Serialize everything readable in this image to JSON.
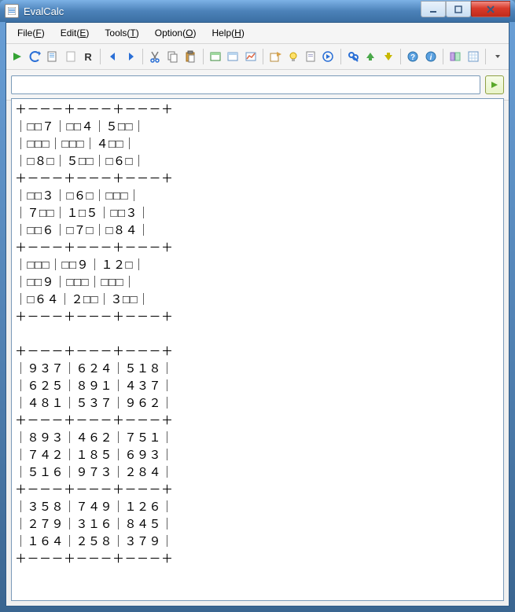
{
  "window": {
    "title": "EvalCalc"
  },
  "menu": {
    "file": {
      "label_pre": "File(",
      "mnemonic": "F",
      "label_post": ")"
    },
    "edit": {
      "label_pre": "Edit(",
      "mnemonic": "E",
      "label_post": ")"
    },
    "tools": {
      "label_pre": "Tools(",
      "mnemonic": "T",
      "label_post": ")"
    },
    "option": {
      "label_pre": "Option(",
      "mnemonic": "O",
      "label_post": ")"
    },
    "help": {
      "label_pre": "Help(",
      "mnemonic": "H",
      "label_post": ")"
    }
  },
  "toolbar": {
    "run_label": "R"
  },
  "input": {
    "expression": "",
    "placeholder": ""
  },
  "output": {
    "lines": [
      "＋－－－＋－－－＋－－－＋",
      "｜□□７｜□□４｜５□□｜",
      "｜□□□｜□□□｜４□□｜",
      "｜□８□｜５□□｜□６□｜",
      "＋－－－＋－－－＋－－－＋",
      "｜□□３｜□６□｜□□□｜",
      "｜７□□｜１□５｜□□３｜",
      "｜□□６｜□７□｜□８４｜",
      "＋－－－＋－－－＋－－－＋",
      "｜□□□｜□□９｜１２□｜",
      "｜□□９｜□□□｜□□□｜",
      "｜□６４｜２□□｜３□□｜",
      "＋－－－＋－－－＋－－－＋",
      "",
      "＋－－－＋－－－＋－－－＋",
      "｜９３７｜６２４｜５１８｜",
      "｜６２５｜８９１｜４３７｜",
      "｜４８１｜５３７｜９６２｜",
      "＋－－－＋－－－＋－－－＋",
      "｜８９３｜４６２｜７５１｜",
      "｜７４２｜１８５｜６９３｜",
      "｜５１６｜９７３｜２８４｜",
      "＋－－－＋－－－＋－－－＋",
      "｜３５８｜７４９｜１２６｜",
      "｜２７９｜３１６｜８４５｜",
      "｜１６４｜２５８｜３７９｜",
      "＋－－－＋－－－＋－－－＋"
    ]
  },
  "chart_data": {
    "type": "table",
    "title": "Sudoku puzzle and solution (9×9)",
    "puzzle_rows": [
      [
        null,
        null,
        7,
        null,
        null,
        4,
        5,
        null,
        null
      ],
      [
        null,
        null,
        null,
        null,
        null,
        null,
        4,
        null,
        null
      ],
      [
        null,
        8,
        null,
        5,
        null,
        null,
        null,
        6,
        null
      ],
      [
        null,
        null,
        3,
        null,
        6,
        null,
        null,
        null,
        null
      ],
      [
        7,
        null,
        null,
        1,
        null,
        5,
        null,
        null,
        3
      ],
      [
        null,
        null,
        6,
        null,
        7,
        null,
        null,
        8,
        4
      ],
      [
        null,
        null,
        null,
        null,
        null,
        9,
        1,
        2,
        null
      ],
      [
        null,
        null,
        9,
        null,
        null,
        null,
        null,
        null,
        null
      ],
      [
        null,
        6,
        4,
        2,
        null,
        null,
        3,
        null,
        null
      ]
    ],
    "solution_rows": [
      [
        9,
        3,
        7,
        6,
        2,
        4,
        5,
        1,
        8
      ],
      [
        6,
        2,
        5,
        8,
        9,
        1,
        4,
        3,
        7
      ],
      [
        4,
        8,
        1,
        5,
        3,
        7,
        9,
        6,
        2
      ],
      [
        8,
        9,
        3,
        4,
        6,
        2,
        7,
        5,
        1
      ],
      [
        7,
        4,
        2,
        1,
        8,
        5,
        6,
        9,
        3
      ],
      [
        5,
        1,
        6,
        9,
        7,
        3,
        2,
        8,
        4
      ],
      [
        3,
        5,
        8,
        7,
        4,
        9,
        1,
        2,
        6
      ],
      [
        2,
        7,
        9,
        3,
        1,
        6,
        8,
        4,
        5
      ],
      [
        1,
        6,
        4,
        2,
        5,
        8,
        3,
        7,
        9
      ]
    ]
  }
}
